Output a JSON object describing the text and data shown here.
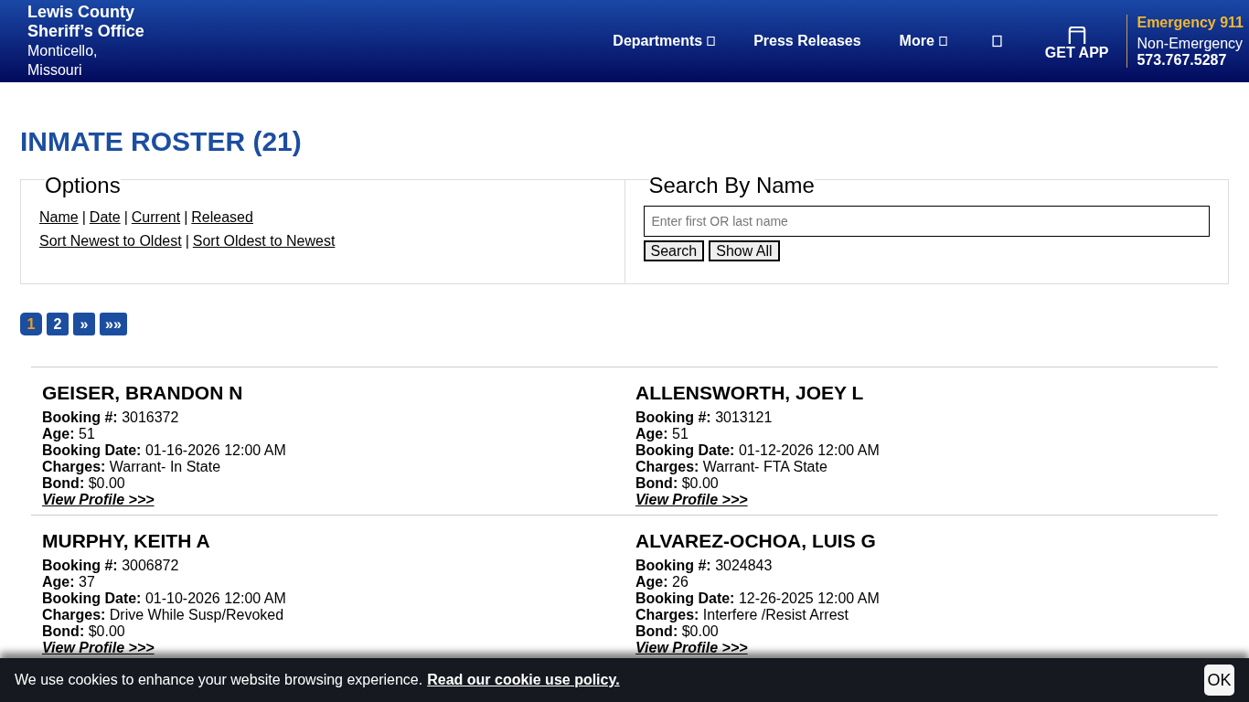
{
  "header": {
    "org_name": "Lewis County\nSheriff’s Office",
    "location": "Monticello,\nMissouri",
    "nav": [
      {
        "label": "Departments",
        "kind": "dropdown"
      },
      {
        "label": "Press Releases",
        "kind": "link"
      },
      {
        "label": "More",
        "kind": "dropdown"
      },
      {
        "kind": "icon"
      }
    ],
    "app_button": "GET APP",
    "emergency": "Emergency 911",
    "non_emergency_label": "Non-Emergency",
    "non_emergency_phone": "573.767.5287"
  },
  "page_title": "INMATE ROSTER (21)",
  "options": {
    "legend": "Options",
    "separator": "|",
    "filters": [
      "Name",
      "Date",
      "Current",
      "Released"
    ],
    "sorts": [
      "Sort Newest to Oldest",
      "Sort Oldest to Newest"
    ]
  },
  "search": {
    "legend": "Search By Name",
    "placeholder": "Enter first OR last name",
    "buttons": [
      "Search",
      "Show All"
    ]
  },
  "pagination": [
    {
      "label": "1",
      "selected": true
    },
    {
      "label": "2",
      "selected": false
    },
    {
      "label": "»",
      "selected": false
    },
    {
      "label": "»»",
      "selected": false
    }
  ],
  "inmates": [
    {
      "name": "GEISER, BRANDON N",
      "fields": [
        {
          "label": "Booking #:",
          "value": "3016372"
        },
        {
          "label": "Age:",
          "value": "51"
        },
        {
          "label": "Booking Date:",
          "value": "01-16-2026 12:00 AM"
        },
        {
          "label": "Charges:",
          "value": "Warrant- In State"
        },
        {
          "label": "Bond:",
          "value": "$0.00"
        }
      ],
      "link": "View Profile >>>"
    },
    {
      "name": "ALLENSWORTH, JOEY L",
      "fields": [
        {
          "label": "Booking #:",
          "value": "3013121"
        },
        {
          "label": "Age:",
          "value": "51"
        },
        {
          "label": "Booking Date:",
          "value": "01-12-2026 12:00 AM"
        },
        {
          "label": "Charges:",
          "value": "Warrant- FTA State"
        },
        {
          "label": "Bond:",
          "value": "$0.00"
        }
      ],
      "link": "View Profile >>>"
    },
    {
      "name": "MURPHY, KEITH A",
      "fields": [
        {
          "label": "Booking #:",
          "value": "3006872"
        },
        {
          "label": "Age:",
          "value": "37"
        },
        {
          "label": "Booking Date:",
          "value": "01-10-2026 12:00 AM"
        },
        {
          "label": "Charges:",
          "value": "Drive While Susp/Revoked"
        },
        {
          "label": "Bond:",
          "value": "$0.00"
        }
      ],
      "link": "View Profile >>>"
    },
    {
      "name": "ALVAREZ-OCHOA, LUIS G",
      "fields": [
        {
          "label": "Booking #:",
          "value": "3024843"
        },
        {
          "label": "Age:",
          "value": "26"
        },
        {
          "label": "Booking Date:",
          "value": "12-26-2025 12:00 AM"
        },
        {
          "label": "Charges:",
          "value": "Interfere /Resist Arrest"
        },
        {
          "label": "Bond:",
          "value": "$0.00"
        }
      ],
      "link": "View Profile >>>"
    }
  ],
  "cookie_bar": {
    "message": "We use cookies to enhance your website browsing experience.",
    "link": "Read our cookie use policy.",
    "button": "OK"
  }
}
